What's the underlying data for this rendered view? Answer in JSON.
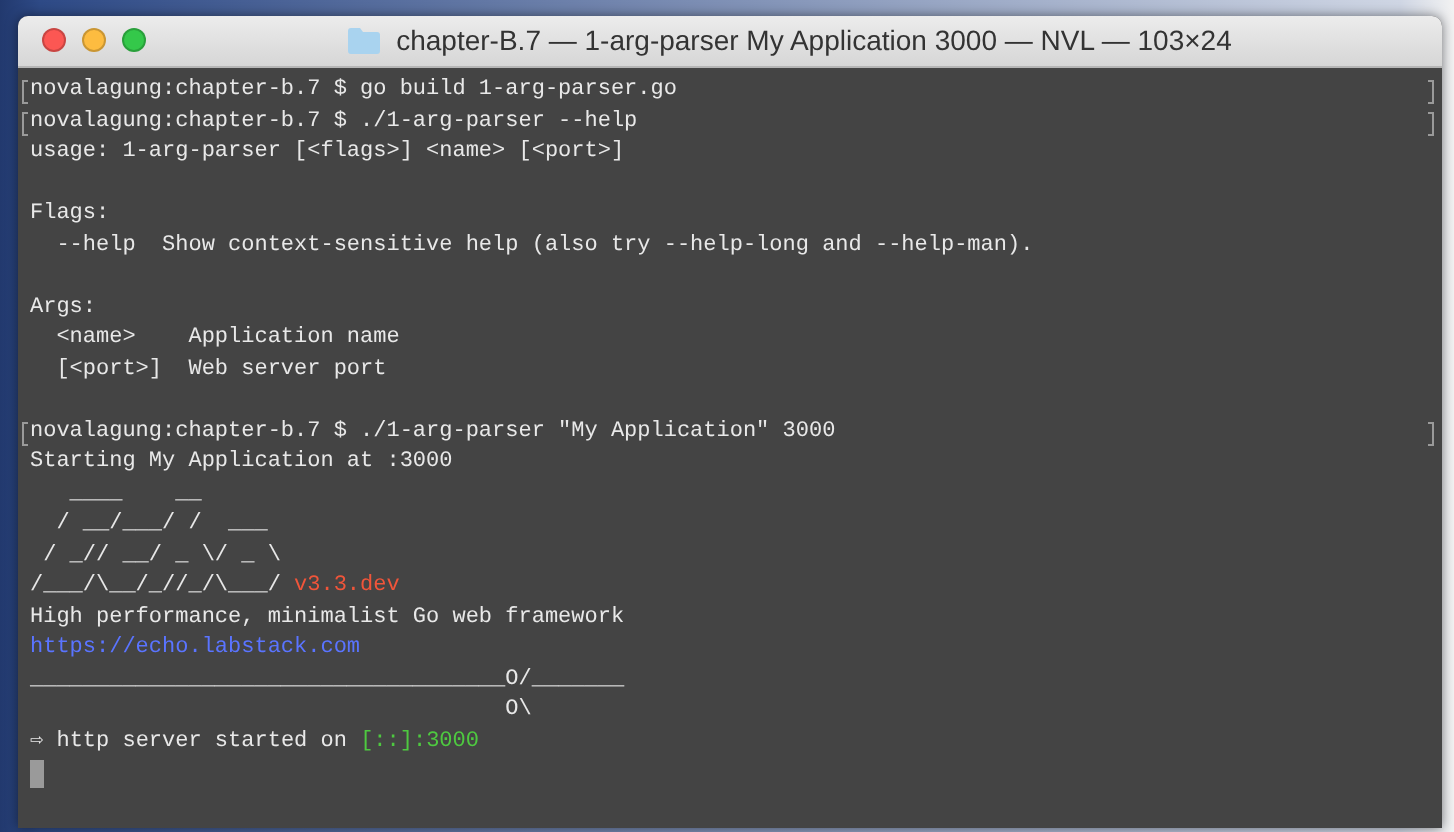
{
  "window": {
    "title": "chapter-B.7 — 1-arg-parser My Application 3000 — NVL — 103×24"
  },
  "terminal": {
    "lines": [
      {
        "kind": "text",
        "marked": true,
        "segments": [
          {
            "kind": "plain",
            "text": "novalagung:chapter-b.7 $ go build 1-arg-parser.go"
          }
        ]
      },
      {
        "kind": "text",
        "marked": true,
        "segments": [
          {
            "kind": "plain",
            "text": "novalagung:chapter-b.7 $ ./1-arg-parser --help"
          }
        ]
      },
      {
        "kind": "text",
        "marked": false,
        "segments": [
          {
            "kind": "plain",
            "text": "usage: 1-arg-parser [<flags>] <name> [<port>]"
          }
        ]
      },
      {
        "kind": "blank"
      },
      {
        "kind": "text",
        "marked": false,
        "segments": [
          {
            "kind": "plain",
            "text": "Flags:"
          }
        ]
      },
      {
        "kind": "text",
        "marked": false,
        "segments": [
          {
            "kind": "plain",
            "text": "  --help  Show context-sensitive help (also try --help-long and --help-man)."
          }
        ]
      },
      {
        "kind": "blank"
      },
      {
        "kind": "text",
        "marked": false,
        "segments": [
          {
            "kind": "plain",
            "text": "Args:"
          }
        ]
      },
      {
        "kind": "text",
        "marked": false,
        "segments": [
          {
            "kind": "plain",
            "text": "  <name>    Application name"
          }
        ]
      },
      {
        "kind": "text",
        "marked": false,
        "segments": [
          {
            "kind": "plain",
            "text": "  [<port>]  Web server port"
          }
        ]
      },
      {
        "kind": "blank"
      },
      {
        "kind": "text",
        "marked": true,
        "segments": [
          {
            "kind": "plain",
            "text": "novalagung:chapter-b.7 $ ./1-arg-parser \"My Application\" 3000"
          }
        ]
      },
      {
        "kind": "text",
        "marked": false,
        "segments": [
          {
            "kind": "plain",
            "text": "Starting My Application at :3000"
          }
        ]
      },
      {
        "kind": "text",
        "marked": false,
        "segments": [
          {
            "kind": "plain",
            "text": "   ____    __"
          }
        ]
      },
      {
        "kind": "text",
        "marked": false,
        "segments": [
          {
            "kind": "plain",
            "text": "  / __/___/ /  ___"
          }
        ]
      },
      {
        "kind": "text",
        "marked": false,
        "segments": [
          {
            "kind": "plain",
            "text": " / _// __/ _ \\/ _ \\"
          }
        ]
      },
      {
        "kind": "text",
        "marked": false,
        "segments": [
          {
            "kind": "plain",
            "text": "/___/\\__/_//_/\\___/"
          },
          {
            "kind": "version",
            "text": "v3.3.dev"
          }
        ]
      },
      {
        "kind": "text",
        "marked": false,
        "segments": [
          {
            "kind": "plain",
            "text": "High performance, minimalist Go web framework"
          }
        ]
      },
      {
        "kind": "text",
        "marked": false,
        "segments": [
          {
            "kind": "link",
            "text": "https://echo.labstack.com"
          }
        ]
      },
      {
        "kind": "text",
        "marked": false,
        "segments": [
          {
            "kind": "plain",
            "text": "____________________________________O/_______"
          }
        ]
      },
      {
        "kind": "text",
        "marked": false,
        "segments": [
          {
            "kind": "plain",
            "text": "                                    O\\"
          }
        ]
      },
      {
        "kind": "text",
        "marked": false,
        "segments": [
          {
            "kind": "plain",
            "text": "⇨ http server started on "
          },
          {
            "kind": "address",
            "text": "[::]:3000"
          }
        ]
      },
      {
        "kind": "cursor"
      }
    ]
  }
}
